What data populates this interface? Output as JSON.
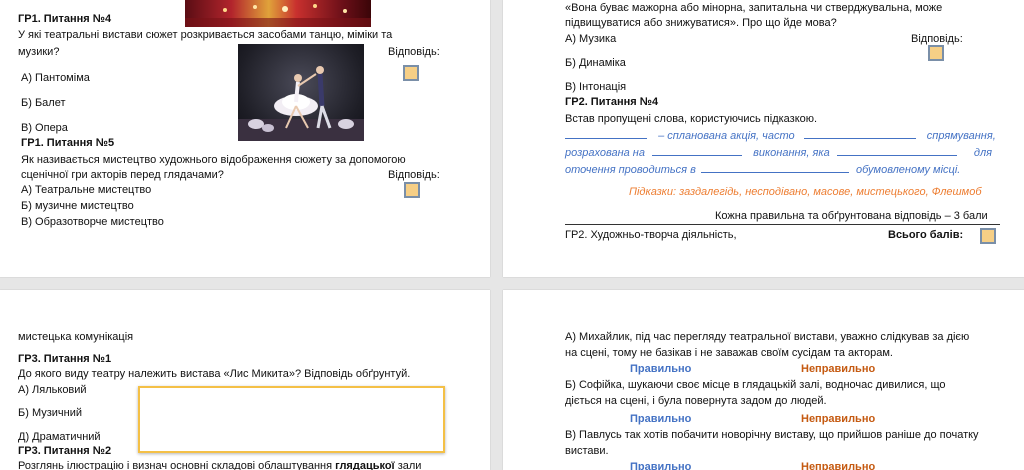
{
  "p1": {
    "q4": {
      "header": "ГР1. Питання №4",
      "text_line1": "У які театральні вистави сюжет розкривається засобами танцю, міміки та",
      "text_line2": "музики?",
      "answer_label": "Відповідь:",
      "options": [
        "А) Пантоміма",
        "Б) Балет",
        "В) Опера"
      ]
    },
    "q5": {
      "header": "ГР1. Питання №5",
      "text_line1": "Як називається мистецтво художнього відображення сюжету за допомогою",
      "text_line2": "сценічної гри акторів перед глядачами?",
      "answer_label": "Відповідь:",
      "options": [
        "А) Театральне мистецтво",
        "Б) музичне мистецтво",
        "В) Образотворче мистецтво"
      ]
    }
  },
  "p2": {
    "intro_line1": "«Вона буває мажорна або мінорна, запитальна чи стверджувальна, може",
    "intro_line2": "підвищуватися або знижуватися». Про що йде мова?",
    "answer_label": "Відповідь:",
    "options": [
      "А) Музика",
      "Б) Динаміка",
      "В) Інтонація"
    ],
    "q4": {
      "header": "ГР2. Питання №4",
      "instruction": "Встав пропущені слова, користуючись підказкою.",
      "line1_a": "– спланована акція, часто",
      "line1_b": "спрямування,",
      "line2_a": "розрахована на",
      "line2_b": "виконання, яка",
      "line2_c": "для",
      "line3_a": "оточення проводиться в",
      "line3_b": "обумовленому місці.",
      "hints": "Підказки: заздалегідь, несподівано, масове, мистецького, Флешмоб"
    },
    "score_note": "Кожна правильна та обґрунтована відповідь – 3 бали",
    "footer_left": "ГР2. Художньо-творча діяльність,",
    "footer_right": "Всього балів:"
  },
  "p3": {
    "carry_text": "мистецька комунікація",
    "q1": {
      "header": "ГР3. Питання №1",
      "text": "До якого виду театру належить вистава «Лис Микита»? Відповідь обґрунтуй.",
      "options": [
        "А) Ляльковий",
        "Б) Музичний",
        "Д) Драматичний"
      ]
    },
    "q2": {
      "header": "ГР3. Питання №2",
      "text_a": "Розглянь ілюстрацію і визнач основні складові облаштування ",
      "text_bold": "глядацької",
      "text_b": " зали"
    }
  },
  "p4": {
    "item_a_line1": "А) Михайлик, під час перегляду театральної вистави, уважно слідкував за дією",
    "item_a_line2": "на сцені, тому не базікав і не заважав своїм сусідам та акторам.",
    "item_b_line1": "Б) Софійка, шукаючи своє місце в глядацькій залі, водночас дивилися, що",
    "item_b_line2": "діється на сцені, і була повернута задом до людей.",
    "item_c_line1": "В) Павлусь так хотів побачити новорічну виставу, що прийшов раніше до початку",
    "item_c_line2": "вистави.",
    "correct_label": "Правильно",
    "wrong_label": "Неправильно"
  },
  "colors": {
    "answer_box": "#f6cf86",
    "blue": "#4472c4",
    "orange": "#ed7d31",
    "yellow_frame": "#f4c046"
  }
}
